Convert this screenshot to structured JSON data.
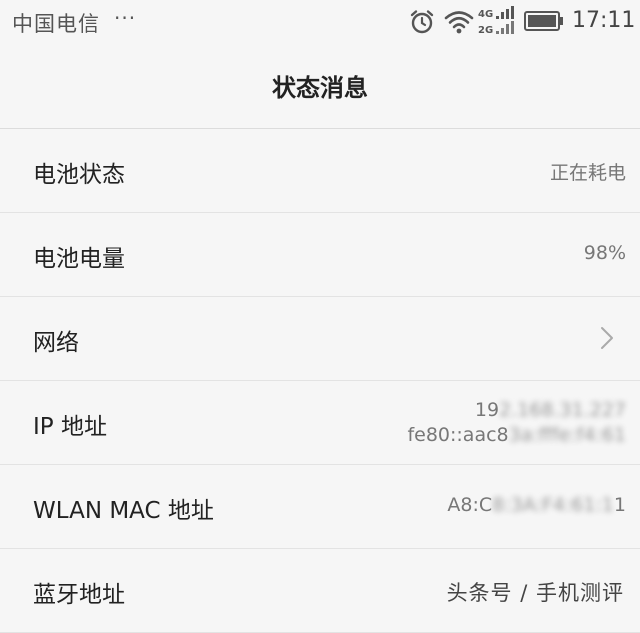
{
  "status_bar": {
    "carrier": "中国电信",
    "more": "···",
    "network_top": "4G",
    "network_bottom": "2G",
    "time": "17:11"
  },
  "header": {
    "title": "状态消息"
  },
  "rows": [
    {
      "label": "电池状态",
      "value": "正在耗电"
    },
    {
      "label": "电池电量",
      "value": "98%"
    },
    {
      "label": "网络",
      "value": ""
    },
    {
      "label": "IP 地址",
      "value_line1_visible": "19",
      "value_line1_blurred": "2.168.31.227",
      "value_line2_visible": "fe80::aac8",
      "value_line2_blurred": "3a:fffe:f4:61"
    },
    {
      "label": "WLAN MAC 地址",
      "value_visible": "A8:C",
      "value_blurred": "8:3A:F4:61:1",
      "value_tail": "1"
    },
    {
      "label": "蓝牙地址",
      "value": ""
    }
  ],
  "watermark": "头条号 / 手机测评",
  "icons": {
    "alarm": "alarm-clock-icon",
    "wifi": "wifi-icon",
    "signal": "cell-signal-icon",
    "battery": "battery-icon",
    "chevron": "chevron-right-icon"
  }
}
